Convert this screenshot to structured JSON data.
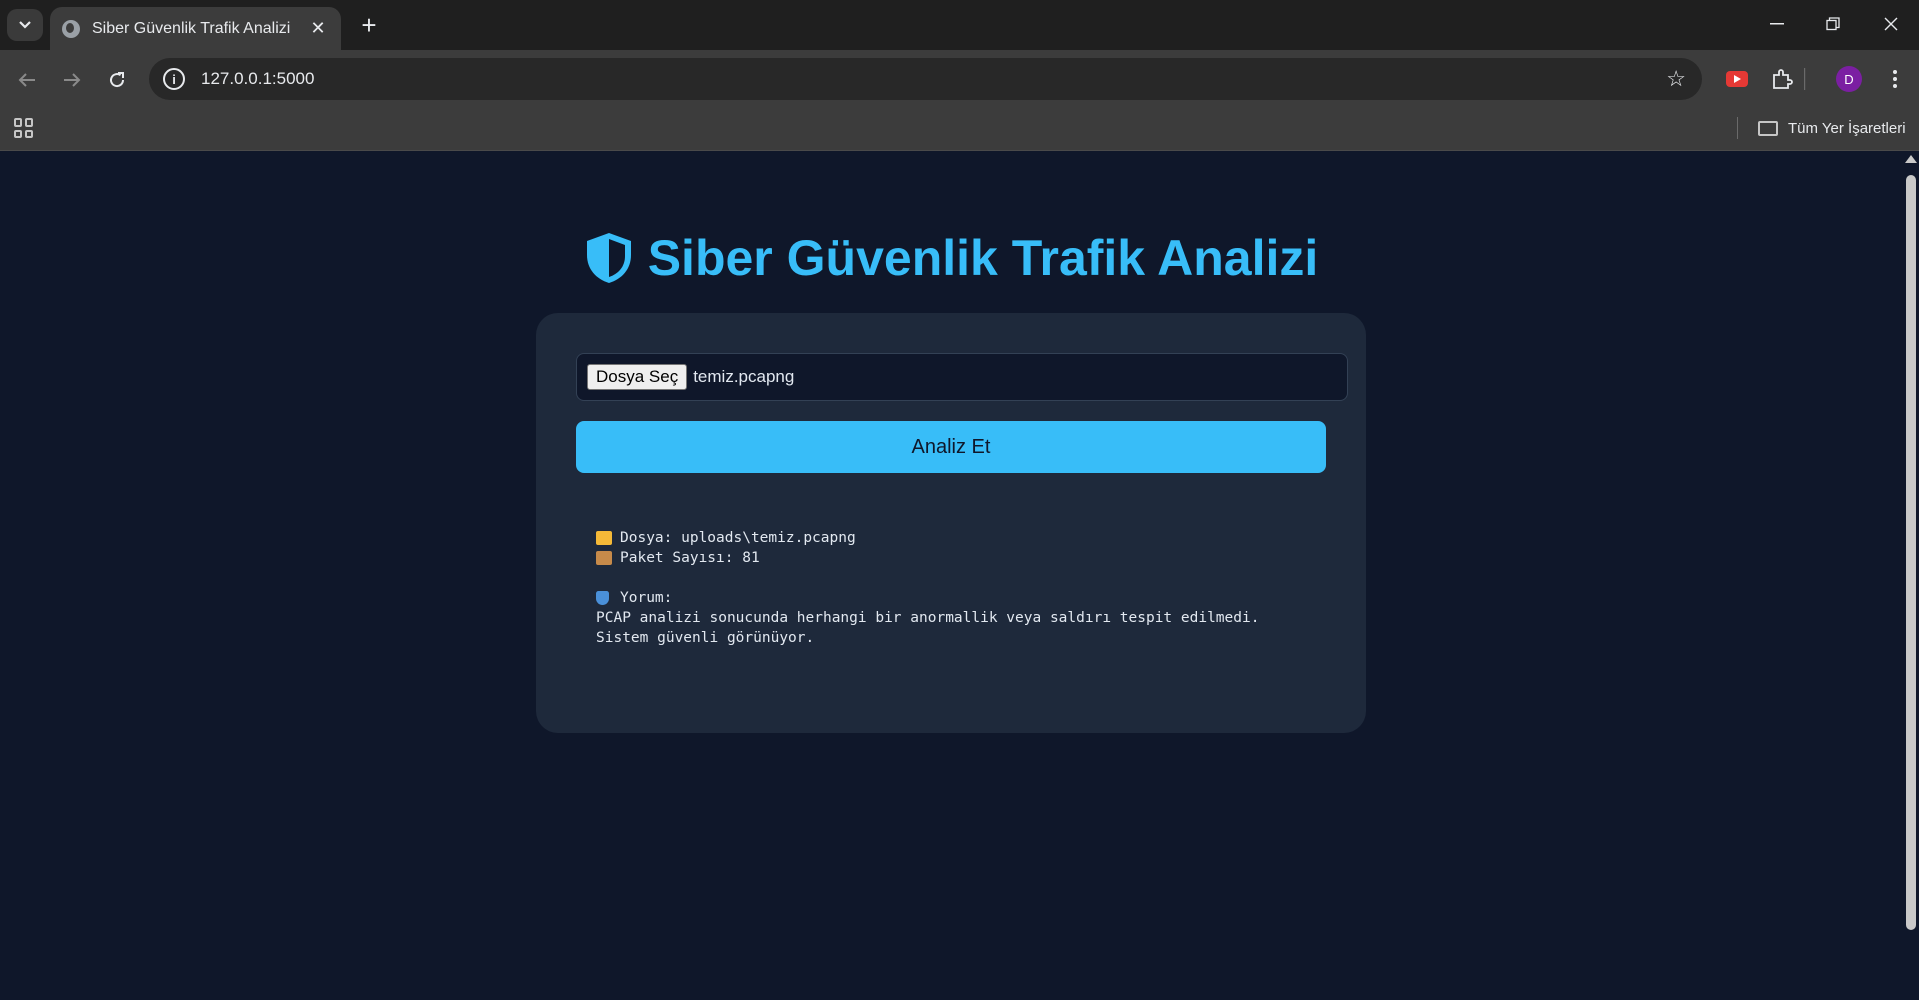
{
  "browser": {
    "tab_title": "Siber Güvenlik Trafik Analizi",
    "url": "127.0.0.1:5000",
    "bookmarks_all_label": "Tüm Yer İşaretleri",
    "profile_initial": "D"
  },
  "page": {
    "title": "Siber Güvenlik Trafik Analizi",
    "file_button_label": "Dosya Seç",
    "file_name": "temiz.pcapng",
    "analyze_button_label": "Analiz Et",
    "result": {
      "file_line": "Dosya: uploads\\temiz.pcapng",
      "packet_line": "Paket Sayısı: 81",
      "comment_label": "Yorum:",
      "comment_line1": "PCAP analizi sonucunda herhangi bir anormallik veya saldırı tespit edilmedi.",
      "comment_line2": "Sistem güvenli görünüyor."
    }
  },
  "colors": {
    "accent": "#38bdf8",
    "background": "#0f172a",
    "card": "#1e293b"
  }
}
